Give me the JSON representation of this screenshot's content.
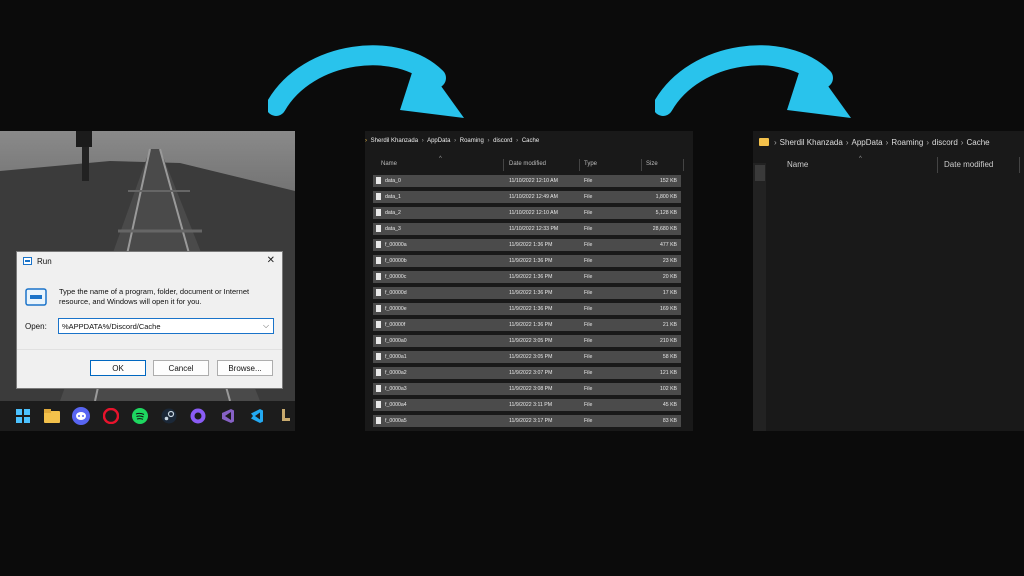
{
  "colors": {
    "background": "#0b0b0b",
    "arrow": "#29c3ec",
    "explorer_bg": "#191919",
    "row_bg": "#4b4b4b",
    "dialog_bg": "#f0f0f0",
    "input_border": "#1a73c9"
  },
  "run_dialog": {
    "title": "Run",
    "description": "Type the name of a program, folder, document or Internet resource, and Windows will open it for you.",
    "open_label": "Open:",
    "open_value": "%APPDATA%/Discord/Cache",
    "ok_label": "OK",
    "cancel_label": "Cancel",
    "browse_label": "Browse...",
    "close_glyph": "✕"
  },
  "taskbar": {
    "icons": [
      "windows-start-icon",
      "file-explorer-icon",
      "discord-icon",
      "opera-icon",
      "spotify-icon",
      "steam-icon",
      "github-icon",
      "visual-studio-icon",
      "vscode-icon",
      "league-icon"
    ]
  },
  "explorer1": {
    "breadcrumb": [
      "Sherdil Khanzada",
      "AppData",
      "Roaming",
      "discord",
      "Cache"
    ],
    "columns": [
      "Name",
      "Date modified",
      "Type",
      "Size"
    ],
    "files": [
      {
        "name": "data_0",
        "date": "11/10/2022 12:10 AM",
        "type": "File",
        "size": "152 KB"
      },
      {
        "name": "data_1",
        "date": "11/10/2022 12:49 AM",
        "type": "File",
        "size": "1,800 KB"
      },
      {
        "name": "data_2",
        "date": "11/10/2022 12:10 AM",
        "type": "File",
        "size": "5,128 KB"
      },
      {
        "name": "data_3",
        "date": "11/10/2022 12:33 PM",
        "type": "File",
        "size": "28,680 KB"
      },
      {
        "name": "f_00000a",
        "date": "11/9/2022 1:36 PM",
        "type": "File",
        "size": "477 KB"
      },
      {
        "name": "f_00000b",
        "date": "11/9/2022 1:36 PM",
        "type": "File",
        "size": "23 KB"
      },
      {
        "name": "f_00000c",
        "date": "11/9/2022 1:36 PM",
        "type": "File",
        "size": "20 KB"
      },
      {
        "name": "f_00000d",
        "date": "11/9/2022 1:36 PM",
        "type": "File",
        "size": "17 KB"
      },
      {
        "name": "f_00000e",
        "date": "11/9/2022 1:36 PM",
        "type": "File",
        "size": "169 KB"
      },
      {
        "name": "f_00000f",
        "date": "11/9/2022 1:36 PM",
        "type": "File",
        "size": "21 KB"
      },
      {
        "name": "f_0000a0",
        "date": "11/9/2022 3:05 PM",
        "type": "File",
        "size": "210 KB"
      },
      {
        "name": "f_0000a1",
        "date": "11/9/2022 3:05 PM",
        "type": "File",
        "size": "58 KB"
      },
      {
        "name": "f_0000a2",
        "date": "11/9/2022 3:07 PM",
        "type": "File",
        "size": "121 KB"
      },
      {
        "name": "f_0000a3",
        "date": "11/9/2022 3:08 PM",
        "type": "File",
        "size": "102 KB"
      },
      {
        "name": "f_0000a4",
        "date": "11/9/2022 3:11 PM",
        "type": "File",
        "size": "45 KB"
      },
      {
        "name": "f_0000a5",
        "date": "11/9/2022 3:17 PM",
        "type": "File",
        "size": "83 KB"
      }
    ]
  },
  "explorer2": {
    "breadcrumb": [
      "Sherdil Khanzada",
      "AppData",
      "Roaming",
      "discord",
      "Cache"
    ],
    "columns": [
      "Name",
      "Date modified"
    ]
  }
}
